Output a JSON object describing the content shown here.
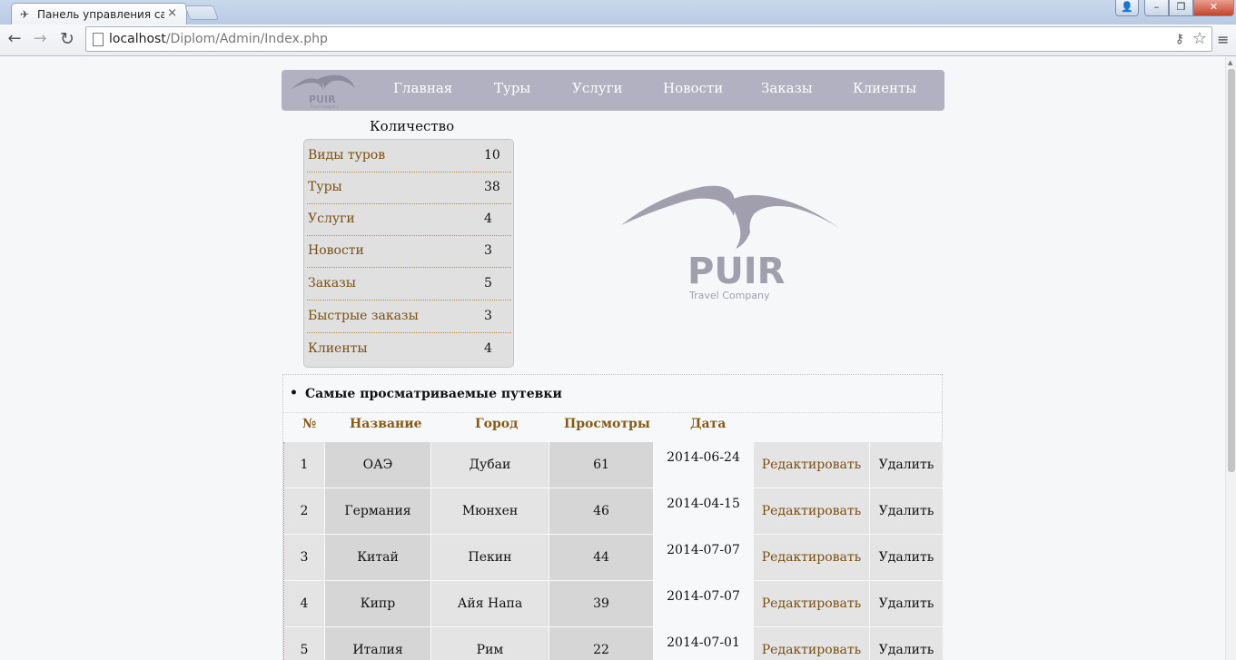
{
  "browser": {
    "tab_title": "Панель управления сайт",
    "url_host": "localhost",
    "url_path": "/Diplom/Admin/Index.php"
  },
  "nav": {
    "logo_text": "PUIR",
    "logo_subtext": "Travel Company",
    "items": [
      "Главная",
      "Туры",
      "Услуги",
      "Новости",
      "Заказы",
      "Клиенты"
    ]
  },
  "counts": {
    "heading": "Количество",
    "rows": [
      {
        "label": "Виды туров",
        "value": "10"
      },
      {
        "label": "Туры",
        "value": "38"
      },
      {
        "label": "Услуги",
        "value": "4"
      },
      {
        "label": "Новости",
        "value": "3"
      },
      {
        "label": "Заказы",
        "value": "5"
      },
      {
        "label": "Быстрые заказы",
        "value": "3"
      },
      {
        "label": "Клиенты",
        "value": "4"
      }
    ]
  },
  "logo": {
    "name": "PUIR",
    "tagline": "Travel Company",
    "color": "#a19fae"
  },
  "popular": {
    "title": "Самые просматриваемые путевки",
    "headers": [
      "№",
      "Название",
      "Город",
      "Просмотры",
      "Дата"
    ],
    "rows": [
      {
        "num": "1",
        "name": "ОАЭ",
        "city": "Дубаи",
        "views": "61",
        "date": "2014-06-24",
        "edit": "Редактировать",
        "delete": "Удалить"
      },
      {
        "num": "2",
        "name": "Германия",
        "city": "Мюнхен",
        "views": "46",
        "date": "2014-04-15",
        "edit": "Редактировать",
        "delete": "Удалить"
      },
      {
        "num": "3",
        "name": "Китай",
        "city": "Пекин",
        "views": "44",
        "date": "2014-07-07",
        "edit": "Редактировать",
        "delete": "Удалить"
      },
      {
        "num": "4",
        "name": "Кипр",
        "city": "Айя Напа",
        "views": "39",
        "date": "2014-07-07",
        "edit": "Редактировать",
        "delete": "Удалить"
      },
      {
        "num": "5",
        "name": "Италия",
        "city": "Рим",
        "views": "22",
        "date": "2014-07-01",
        "edit": "Редактировать",
        "delete": "Удалить"
      }
    ]
  },
  "colors": {
    "nav_bg": "#b2b1c1",
    "link": "#7a4f10",
    "header_text": "#8a5a12"
  }
}
